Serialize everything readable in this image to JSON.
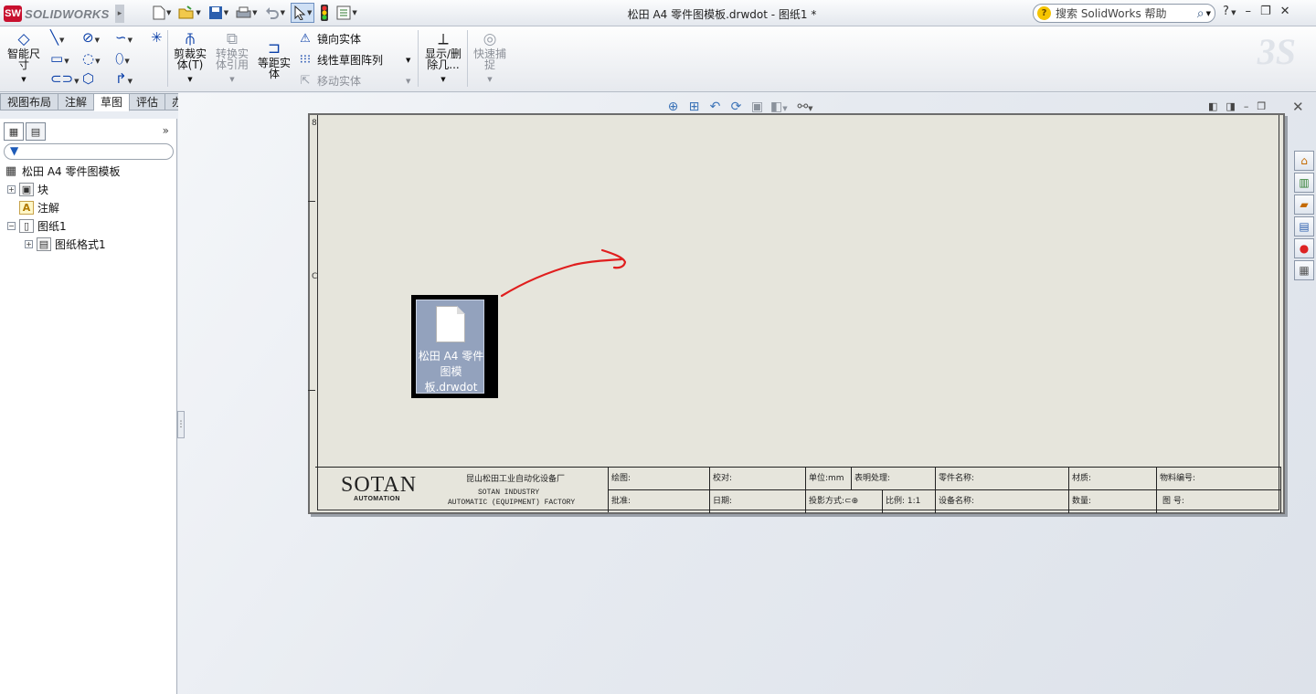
{
  "app": {
    "brand": "SOLIDWORKS",
    "window_title": "松田 A4 零件图模板.drwdot - 图纸1 *",
    "search_placeholder": "搜索 SolidWorks 帮助",
    "help_menu": "?"
  },
  "quick_access": [
    "new-icon",
    "open-icon",
    "save-icon",
    "print-icon",
    "undo-icon",
    "select-icon",
    "rebuild-icon",
    "options-icon"
  ],
  "ribbon": {
    "smart_dimension": "智能尺寸",
    "trim": "剪裁实体(T)",
    "convert": "转换实体引用",
    "offset": "等距实体",
    "mirror": "镜向实体",
    "linear_pattern": "线性草图阵列",
    "move": "移动实体",
    "show_hide": "显示/删除几...",
    "quick_snaps": "快速捕捉"
  },
  "cm_tabs": [
    "视图布局",
    "注解",
    "草图",
    "评估",
    "办公室产品"
  ],
  "cm_active_tab": "草图",
  "feature_tree": {
    "root": "松田 A4 零件图模板",
    "items": [
      {
        "label": "块",
        "expander": "+"
      },
      {
        "label": "注解",
        "expander": ""
      },
      {
        "label": "图纸1",
        "expander": "−"
      },
      {
        "label": "图纸格式1",
        "expander": "+"
      }
    ]
  },
  "sheet": {
    "zone_labels": [
      "8",
      "C"
    ]
  },
  "title_block": {
    "logo": "SOTAN",
    "logo_sub": "AUTOMATION",
    "company_cn": "昆山松田工业自动化设备厂",
    "company_en1": "SOTAN INDUSTRY",
    "company_en2": "AUTOMATIC (EQUIPMENT) FACTORY",
    "draw": "绘图:",
    "check": "校对:",
    "unit": "单位:mm",
    "surface": "表明处理:",
    "part_name": "零件名称:",
    "material": "材质:",
    "material_no": "物料编号:",
    "approve": "批准:",
    "date": "日期:",
    "projection": "投影方式:",
    "scale": "比例: 1:1",
    "equipment_name": "设备名称:",
    "quantity": "数量:",
    "drawing_no": "图  号:"
  },
  "drag_file": {
    "name": "松田 A4 零件图模板.drwdot"
  },
  "colors": {
    "annotation_arrow": "#e01e1e",
    "sheet_bg": "#e6e5dc",
    "drag_highlight": "#93a2bd"
  }
}
